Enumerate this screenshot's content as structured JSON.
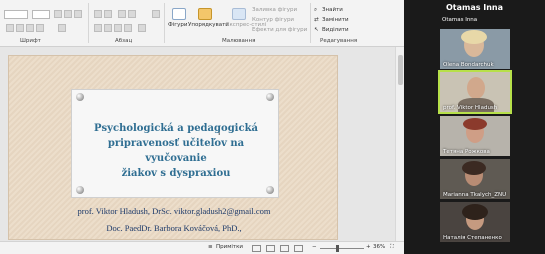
{
  "ribbon": {
    "groups": {
      "font": "Шрифт",
      "paragraph": "Абзац",
      "drawing": "Малювання",
      "editing": "Редагування"
    },
    "shapes_label": "Фігури",
    "arrange_label": "Упорядкувати",
    "quick_styles_label": "Експрес-стилі",
    "shape_fill": "Заливка фігури",
    "shape_outline": "Контур фігури",
    "shape_effects": "Ефекти для фігури",
    "find": "Знайти",
    "replace": "Замінити",
    "select": "Виділити"
  },
  "slide": {
    "title_lines": [
      "Psychologická a pedagogická",
      "pripravenosť učiteľov na vyučovanie",
      "žiakov s dyspraxiou"
    ],
    "author_line_1": "prof. Viktor Hladush, DrSc. viktor.gladush2@gmail.com",
    "author_line_2": "Doc. PaedDr. Barbora Kováčová, PhD.,"
  },
  "status": {
    "notes_label": "Примітки",
    "zoom": "36%"
  },
  "zoom_level": 0.36,
  "panel": {
    "host_name": "Otamas Inna",
    "top_label": "Otamas Inna",
    "participants": [
      "Olena Bondarchuk",
      "prof. Viktor Hladush",
      "Тетяна Рожкова",
      "Marianna Tkalych_ZNU",
      "Наталія Степаненко"
    ]
  },
  "colors": {
    "title_blue": "#2f6e92",
    "active_speaker": "#b7e04a"
  }
}
